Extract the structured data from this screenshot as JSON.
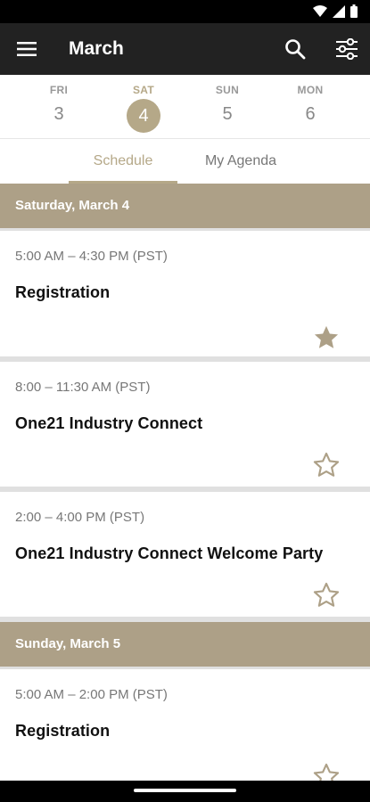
{
  "app_bar": {
    "title": "March",
    "menu_icon": "hamburger-menu-icon",
    "search_icon": "search-icon",
    "filter_icon": "filter-sliders-icon"
  },
  "status_bar": {
    "icons": [
      "wifi-icon",
      "cellular-signal-icon",
      "battery-icon"
    ]
  },
  "dates": [
    {
      "dow": "FRI",
      "num": "3",
      "selected": false
    },
    {
      "dow": "SAT",
      "num": "4",
      "selected": true
    },
    {
      "dow": "SUN",
      "num": "5",
      "selected": false
    },
    {
      "dow": "MON",
      "num": "6",
      "selected": false
    }
  ],
  "tabs": [
    {
      "label": "Schedule",
      "active": true
    },
    {
      "label": "My Agenda",
      "active": false
    }
  ],
  "sections": [
    {
      "header": "Saturday, March 4",
      "sessions": [
        {
          "time": "5:00 AM – 4:30 PM (PST)",
          "title": "Registration",
          "starred": true
        },
        {
          "time": "8:00 – 11:30 AM (PST)",
          "title": "One21 Industry Connect",
          "starred": false
        },
        {
          "time": "2:00 – 4:00 PM (PST)",
          "title": "One21 Industry Connect Welcome Party",
          "starred": false
        }
      ]
    },
    {
      "header": "Sunday, March 5",
      "sessions": [
        {
          "time": "5:00 AM – 2:00 PM (PST)",
          "title": "Registration",
          "starred": false
        }
      ]
    }
  ],
  "colors": {
    "accent": "#b5a888",
    "section_header": "#ada087",
    "app_bar": "#222222"
  }
}
